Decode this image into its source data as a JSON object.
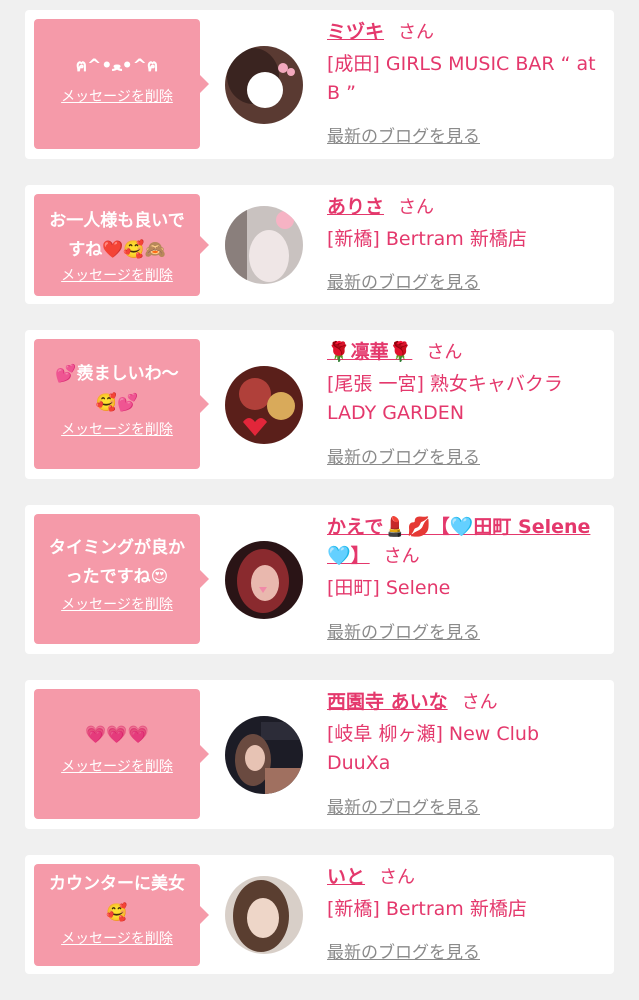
{
  "colors": {
    "bubble": "#f59aa9",
    "accent": "#e4386c",
    "muted": "#8a8a8a",
    "page_bg": "#f0f0f0"
  },
  "cards": [
    {
      "message": "ฅ^•ﻌ•^ฅ",
      "delete_label": "メッセージを削除",
      "name": "ミヅキ",
      "honorific": "さん",
      "shop": "[成田] GIRLS MUSIC BAR “ at B ”",
      "blog_link": "最新のブログを見る"
    },
    {
      "message": "お一人様も良いですね❤️🥰🙈",
      "delete_label": "メッセージを削除",
      "name": "ありさ",
      "honorific": "さん",
      "shop": "[新橋] Bertram 新橋店",
      "blog_link": "最新のブログを見る"
    },
    {
      "message": "💕羨ましいわ〜🥰💕",
      "delete_label": "メッセージを削除",
      "name": "🌹凛華🌹",
      "honorific": "さん",
      "shop": "[尾張 一宮] 熟女キャバクラ LADY GARDEN",
      "blog_link": "最新のブログを見る"
    },
    {
      "message": "タイミングが良かったですね😍",
      "delete_label": "メッセージを削除",
      "name": "かえで💄💋【🩵田町 Selene🩵】",
      "honorific": "さん",
      "shop": "[田町] Selene",
      "blog_link": "最新のブログを見る"
    },
    {
      "message": "💗💗💗",
      "delete_label": "メッセージを削除",
      "name": "西園寺 あいな",
      "honorific": "さん",
      "shop": "[岐阜 柳ヶ瀬] New Club DuuXa",
      "blog_link": "最新のブログを見る"
    },
    {
      "message": "カウンターに美女🥰",
      "delete_label": "メッセージを削除",
      "name": "いと",
      "honorific": "さん",
      "shop": "[新橋] Bertram 新橋店",
      "blog_link": "最新のブログを見る"
    }
  ]
}
